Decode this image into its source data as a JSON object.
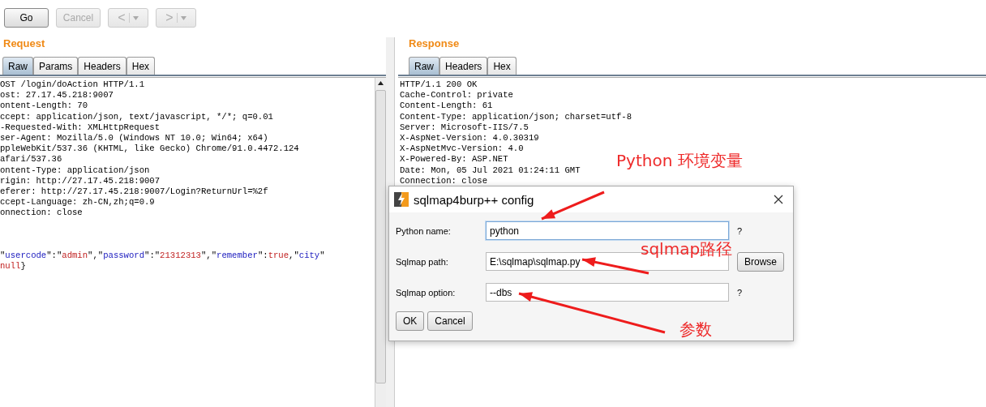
{
  "toolbar": [
    {
      "label": "Go",
      "disabled": false,
      "kind": "text"
    },
    {
      "label": "Cancel",
      "disabled": true,
      "kind": "text"
    },
    {
      "label": "<",
      "disabled": true,
      "kind": "nav"
    },
    {
      "label": ">",
      "disabled": true,
      "kind": "nav"
    }
  ],
  "request": {
    "title": "Request",
    "tabs": [
      {
        "label": "Raw",
        "selected": true
      },
      {
        "label": "Params",
        "selected": false
      },
      {
        "label": "Headers",
        "selected": false
      },
      {
        "label": "Hex",
        "selected": false
      }
    ],
    "lines": [
      "OST /login/doAction HTTP/1.1",
      "ost: 27.17.45.218:9007",
      "ontent-Length: 70",
      "ccept: application/json, text/javascript, */*; q=0.01",
      "-Requested-With: XMLHttpRequest",
      "ser-Agent: Mozilla/5.0 (Windows NT 10.0; Win64; x64)",
      "ppleWebKit/537.36 (KHTML, like Gecko) Chrome/91.0.4472.124",
      "afari/537.36",
      "ontent-Type: application/json",
      "rigin: http://27.17.45.218:9007",
      "eferer: http://27.17.45.218:9007/Login?ReturnUrl=%2f",
      "ccept-Language: zh-CN,zh;q=0.9",
      "onnection: close"
    ],
    "body": [
      [
        {
          "kind": "punct",
          "text": "\""
        },
        {
          "kind": "key",
          "text": "usercode"
        },
        {
          "kind": "punct",
          "text": "\":\""
        },
        {
          "kind": "value",
          "text": "admin"
        },
        {
          "kind": "punct",
          "text": "\",\""
        },
        {
          "kind": "key",
          "text": "password"
        },
        {
          "kind": "punct",
          "text": "\":\""
        },
        {
          "kind": "value",
          "text": "21312313"
        },
        {
          "kind": "punct",
          "text": "\",\""
        },
        {
          "kind": "key",
          "text": "remember"
        },
        {
          "kind": "punct",
          "text": "\":"
        },
        {
          "kind": "value",
          "text": "true"
        },
        {
          "kind": "punct",
          "text": ",\""
        },
        {
          "kind": "key",
          "text": "city"
        },
        {
          "kind": "punct",
          "text": "\""
        }
      ],
      [
        {
          "kind": "value",
          "text": "null"
        },
        {
          "kind": "punct",
          "text": "}"
        }
      ]
    ]
  },
  "response": {
    "title": "Response",
    "tabs": [
      {
        "label": "Raw",
        "selected": true
      },
      {
        "label": "Headers",
        "selected": false
      },
      {
        "label": "Hex",
        "selected": false
      }
    ],
    "lines": [
      "HTTP/1.1 200 OK",
      "Cache-Control: private",
      "Content-Length: 61",
      "Content-Type: application/json; charset=utf-8",
      "Server: Microsoft-IIS/7.5",
      "X-AspNet-Version: 4.0.30319",
      "X-AspNetMvc-Version: 4.0",
      "X-Powered-By: ASP.NET",
      "Date: Mon, 05 Jul 2021 01:24:11 GMT",
      "Connection: close"
    ]
  },
  "dialog": {
    "title": "sqlmap4burp++ config",
    "fields": [
      {
        "label": "Python name:",
        "value": "python",
        "focused": true,
        "kind": "help",
        "extra": "?"
      },
      {
        "label": "Sqlmap path:",
        "value": "E:\\sqlmap\\sqlmap.py",
        "focused": false,
        "kind": "browse",
        "extra": "Browse"
      },
      {
        "label": "Sqlmap option:",
        "value": "--dbs",
        "focused": false,
        "kind": "help",
        "extra": "?"
      }
    ],
    "buttons": [
      "OK",
      "Cancel"
    ]
  },
  "annotations": [
    "Python 环境变量",
    "sqlmap路径",
    "参数"
  ]
}
